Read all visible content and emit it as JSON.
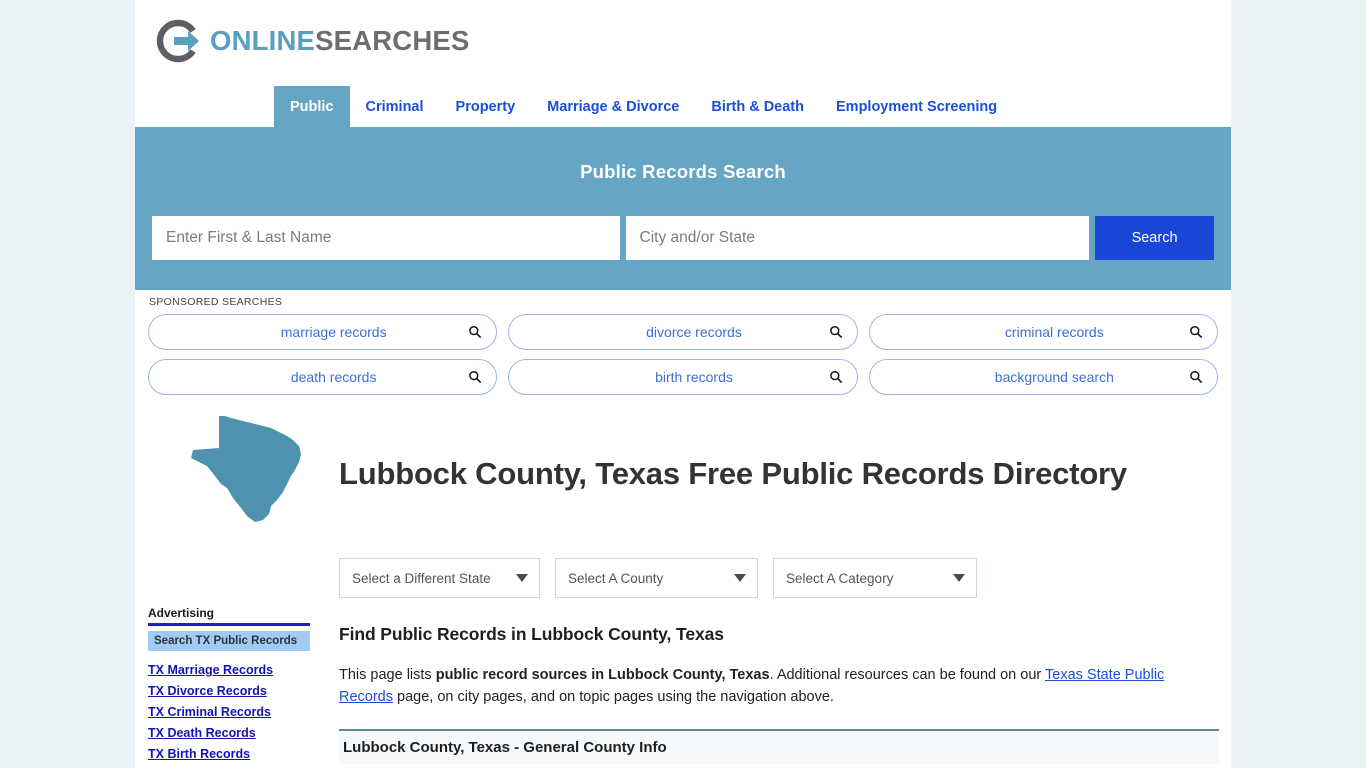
{
  "site": {
    "logo_primary": "ONLINE",
    "logo_secondary": "SEARCHES",
    "accent_teal": "#66a6c4",
    "accent_blue": "#1a46d8",
    "link_blue": "#1a4fd6"
  },
  "nav": {
    "items": [
      {
        "label": "Public",
        "active": true
      },
      {
        "label": "Criminal",
        "active": false
      },
      {
        "label": "Property",
        "active": false
      },
      {
        "label": "Marriage & Divorce",
        "active": false
      },
      {
        "label": "Birth & Death",
        "active": false
      },
      {
        "label": "Employment Screening",
        "active": false
      }
    ]
  },
  "search": {
    "title": "Public Records Search",
    "name_placeholder": "Enter First & Last Name",
    "name_value": "",
    "location_placeholder": "City and/or State",
    "location_value": "",
    "button_label": "Search"
  },
  "sponsored": {
    "label": "SPONSORED SEARCHES",
    "items": [
      {
        "label": "marriage records",
        "icon": "magnifier-icon"
      },
      {
        "label": "divorce records",
        "icon": "magnifier-icon"
      },
      {
        "label": "criminal records",
        "icon": "magnifier-icon"
      },
      {
        "label": "death records",
        "icon": "magnifier-icon"
      },
      {
        "label": "birth records",
        "icon": "magnifier-icon"
      },
      {
        "label": "background search",
        "icon": "magnifier-icon"
      }
    ]
  },
  "hero": {
    "state_icon": "texas-state-outline-icon",
    "title": "Lubbock County, Texas Free Public Records Directory"
  },
  "selectors": [
    {
      "label": "Select a Different State",
      "icon": "chevron-down-icon"
    },
    {
      "label": "Select A County",
      "icon": "chevron-down-icon"
    },
    {
      "label": "Select A Category",
      "icon": "chevron-down-icon"
    }
  ],
  "sidebar": {
    "advertising_label": "Advertising",
    "ad_heading": "Search TX Public Records",
    "links": [
      "TX Marriage Records",
      "TX Divorce Records",
      "TX Criminal Records",
      "TX Death Records",
      "TX Birth Records"
    ]
  },
  "main": {
    "section_heading": "Find Public Records in Lubbock County, Texas",
    "para_lead": "This page lists ",
    "para_bold": "public record sources in Lubbock County, Texas",
    "para_mid": ". Additional resources can be found on our ",
    "para_link": "Texas State Public Records",
    "para_tail": " page, on city pages, and on topic pages using the navigation above.",
    "table_heading": "Lubbock County, Texas - General County Info"
  }
}
